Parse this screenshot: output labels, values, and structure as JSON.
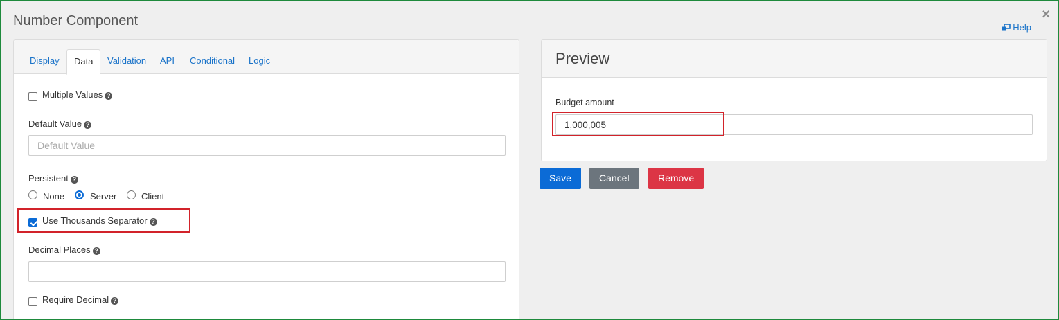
{
  "dialog": {
    "title": "Number Component",
    "close_symbol": "×",
    "help_label": "Help",
    "help_icon": "external-link-icon",
    "frame_color": "#1e8a3c"
  },
  "tabs": [
    {
      "label": "Display",
      "active": false
    },
    {
      "label": "Data",
      "active": true
    },
    {
      "label": "Validation",
      "active": false
    },
    {
      "label": "API",
      "active": false
    },
    {
      "label": "Conditional",
      "active": false
    },
    {
      "label": "Logic",
      "active": false
    }
  ],
  "form": {
    "multiple_values": {
      "label": "Multiple Values",
      "checked": false
    },
    "default_value": {
      "label": "Default Value",
      "placeholder": "Default Value",
      "value": ""
    },
    "persistent": {
      "label": "Persistent",
      "options": [
        "None",
        "Server",
        "Client"
      ],
      "selected": "Server"
    },
    "thousands_separator": {
      "label": "Use Thousands Separator",
      "checked": true
    },
    "decimal_places": {
      "label": "Decimal Places",
      "value": ""
    },
    "require_decimal": {
      "label": "Require Decimal",
      "checked": false
    },
    "help_icon": "question-circle-icon"
  },
  "preview": {
    "title": "Preview",
    "field_label": "Budget amount",
    "field_value": "1,000,005"
  },
  "buttons": {
    "save": "Save",
    "cancel": "Cancel",
    "remove": "Remove"
  },
  "colors": {
    "accent": "#1a73c9",
    "save": "#0b6bd6",
    "cancel": "#6c757d",
    "remove": "#dc3545",
    "highlight": "#d2232a"
  }
}
